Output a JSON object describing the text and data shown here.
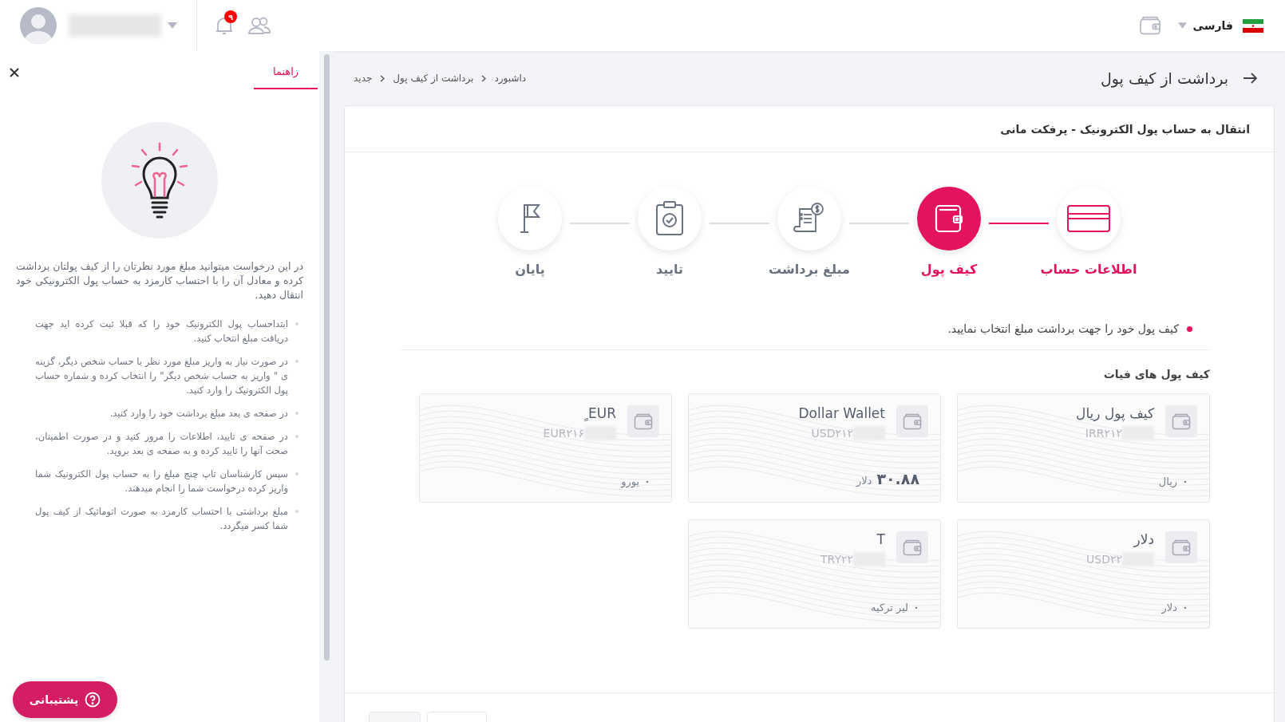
{
  "topbar": {
    "language": "فارسی",
    "notification_count": "۹"
  },
  "help_panel": {
    "tabs": [
      {
        "label": "راهنما",
        "selected": true
      }
    ],
    "intro": "در این درخواست میتوانید مبلغ مورد نظرتان را از کیف پولتان برداشت کرده و معادل آن را با احتساب کارمزد به حساب پول الکترونیکی خود انتقال دهید.",
    "bullets": [
      "ابتداحساب پول الکترونیک خود را که قبلا ثبت کرده اید جهت دریافت مبلغ انتخاب کنید.",
      "در صورت نیاز به واریز مبلغ مورد نظر با حساب شخص دیگر، گزینه ی \" واریز به حساب شخص دیگر\" را انتخاب کرده و شماره حساب پول الکترونیک  را وارد کنید.",
      "در صفحه ی بعد مبلغ برداشت خود را وارد کنید.",
      "در صفحه ی تایید، اطلاعات را مرور کنید و در صورت اطمینان، صحت آنها را تایید کرده و به صفحه ی بعد بروید.",
      "سپس کارشناسان تاپ چنج مبلغ را به حساب پول الکترونیک شما واریز کرده درخواست شما را انجام میدهند.",
      "مبلغ برداشتی با احتساب کارمزد به صورت اتوماتیک از کیف پول شما کسر میگردد."
    ],
    "support_button": "پشتیبانی"
  },
  "page": {
    "title": "برداشت از کیف پول",
    "breadcrumb": [
      "داشبورد",
      "برداشت از کیف پول",
      "جدید"
    ]
  },
  "card": {
    "title": "انتقال به حساب پول الکترونیک - پرفکت مانی",
    "steps": [
      {
        "label": "اطلاعات حساب",
        "kind": "card",
        "completed": true,
        "selected": false
      },
      {
        "label": "کیف پول",
        "kind": "wallet",
        "completed": false,
        "selected": true
      },
      {
        "label": "مبلغ برداشت",
        "kind": "receipt",
        "completed": false,
        "selected": false
      },
      {
        "label": "تایید",
        "kind": "clipboard",
        "completed": false,
        "selected": false
      },
      {
        "label": "پایان",
        "kind": "flag",
        "completed": false,
        "selected": false
      }
    ],
    "instruction": "کیف پول خود را جهت برداشت مبلغ انتخاب نمایید.",
    "section_title": "کیف پول های فیات",
    "wallets": [
      {
        "name": "کیف پول ریال",
        "account": "IRR۲۱۲",
        "amount": "۰",
        "unit": "ریال",
        "highlight": false
      },
      {
        "name": "Dollar Wallet",
        "account": "USD۲۱۲",
        "amount": "۳۰.۸۸",
        "unit": "دلار",
        "highlight": true
      },
      {
        "name": "EUR ٍ",
        "account": "EUR۲۱۶",
        "amount": "۰",
        "unit": "یورو",
        "highlight": false
      },
      {
        "name": "دلار",
        "account": "USD۲۲",
        "amount": "۰",
        "unit": "دلار",
        "highlight": false
      },
      {
        "name": "T",
        "account": "TRY۲۲",
        "amount": "۰",
        "unit": "لیر ترکیه",
        "highlight": false
      }
    ]
  }
}
